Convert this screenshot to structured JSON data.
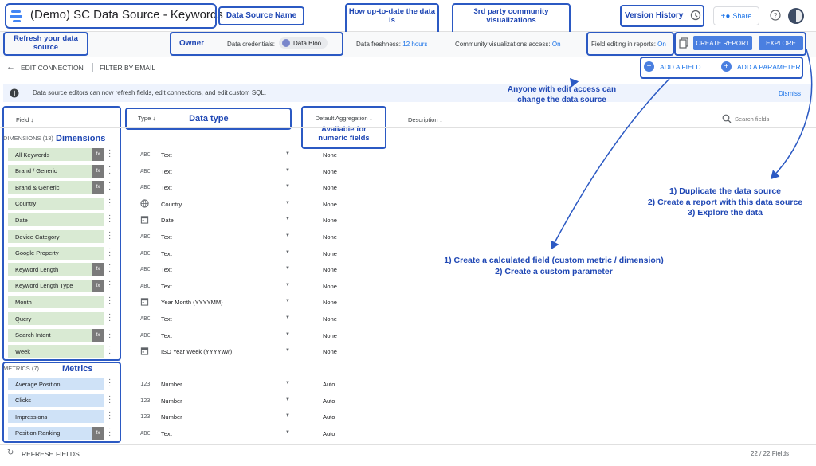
{
  "header": {
    "title": "(Demo) SC Data Source - Keywords",
    "share_label": "Share"
  },
  "secondary": {
    "credentials_label": "Data credentials:",
    "credentials_owner": "Data Bloo",
    "freshness_label": "Data freshness:",
    "freshness_value": "12 hours",
    "community_label": "Community visualizations access:",
    "community_value": "On",
    "field_editing_label": "Field editing in reports:",
    "field_editing_value": "On",
    "create_report": "CREATE REPORT",
    "explore": "EXPLORE"
  },
  "toolbar": {
    "edit_connection": "EDIT CONNECTION",
    "filter_by_email": "FILTER BY EMAIL",
    "add_field": "ADD A FIELD",
    "add_parameter": "ADD A PARAMETER"
  },
  "infobar": {
    "message": "Data source editors can now refresh fields, edit connections, and edit custom SQL.",
    "dismiss": "Dismiss"
  },
  "columns": {
    "field": "Field",
    "type": "Type",
    "aggregation": "Default Aggregation",
    "description": "Description",
    "search_placeholder": "Search fields"
  },
  "sections": {
    "dimensions": "DIMENSIONS (13)",
    "metrics": "METRICS (7)"
  },
  "dimensions": [
    {
      "name": "All Keywords",
      "fx": true,
      "type_icon": "ABC",
      "type": "Text",
      "agg": "None"
    },
    {
      "name": "Brand / Generic",
      "fx": true,
      "type_icon": "ABC",
      "type": "Text",
      "agg": "None"
    },
    {
      "name": "Brand & Generic",
      "fx": true,
      "type_icon": "ABC",
      "type": "Text",
      "agg": "None"
    },
    {
      "name": "Country",
      "fx": false,
      "type_icon": "globe",
      "type": "Country",
      "agg": "None"
    },
    {
      "name": "Date",
      "fx": false,
      "type_icon": "calendar",
      "type": "Date",
      "agg": "None"
    },
    {
      "name": "Device Category",
      "fx": false,
      "type_icon": "ABC",
      "type": "Text",
      "agg": "None"
    },
    {
      "name": "Google Property",
      "fx": false,
      "type_icon": "ABC",
      "type": "Text",
      "agg": "None"
    },
    {
      "name": "Keyword Length",
      "fx": true,
      "type_icon": "ABC",
      "type": "Text",
      "agg": "None"
    },
    {
      "name": "Keyword Length Type",
      "fx": true,
      "type_icon": "ABC",
      "type": "Text",
      "agg": "None"
    },
    {
      "name": "Month",
      "fx": false,
      "type_icon": "calendar",
      "type": "Year Month (YYYYMM)",
      "agg": "None"
    },
    {
      "name": "Query",
      "fx": false,
      "type_icon": "ABC",
      "type": "Text",
      "agg": "None"
    },
    {
      "name": "Search Intent",
      "fx": true,
      "type_icon": "ABC",
      "type": "Text",
      "agg": "None"
    },
    {
      "name": "Week",
      "fx": false,
      "type_icon": "calendar",
      "type": "ISO Year Week (YYYYww)",
      "agg": "None"
    }
  ],
  "metrics": [
    {
      "name": "Average Position",
      "fx": false,
      "type_icon": "123",
      "type": "Number",
      "agg": "Auto"
    },
    {
      "name": "Clicks",
      "fx": false,
      "type_icon": "123",
      "type": "Number",
      "agg": "Auto"
    },
    {
      "name": "Impressions",
      "fx": false,
      "type_icon": "123",
      "type": "Number",
      "agg": "Auto"
    },
    {
      "name": "Position Ranking",
      "fx": true,
      "type_icon": "ABC",
      "type": "Text",
      "agg": "Auto"
    }
  ],
  "footer": {
    "refresh": "REFRESH FIELDS",
    "count": "22 / 22 Fields"
  },
  "annotations": {
    "data_source_name": "Data Source Name",
    "freshness_note": "How up-to-date the data is",
    "community_note": "3rd party community visualizations",
    "version_history": "Version History",
    "refresh_source": "Refresh your data source",
    "owner": "Owner",
    "dimensions": "Dimensions",
    "data_type": "Data type",
    "numeric_fields": "Available for numeric fields",
    "metrics": "Metrics",
    "edit_access": "Anyone with edit access can change the data source",
    "actions_1": "1) Duplicate the data source",
    "actions_2": "2) Create a report with this data source",
    "actions_3": "3) Explore the data",
    "calc_1": "1) Create a calculated field (custom metric / dimension)",
    "calc_2": "2) Create a custom parameter"
  },
  "colors": {
    "accent": "#4a7fe0",
    "annotation": "#2b59c3",
    "dimension_pill": "#d9ead3",
    "metric_pill": "#cfe2f7"
  }
}
